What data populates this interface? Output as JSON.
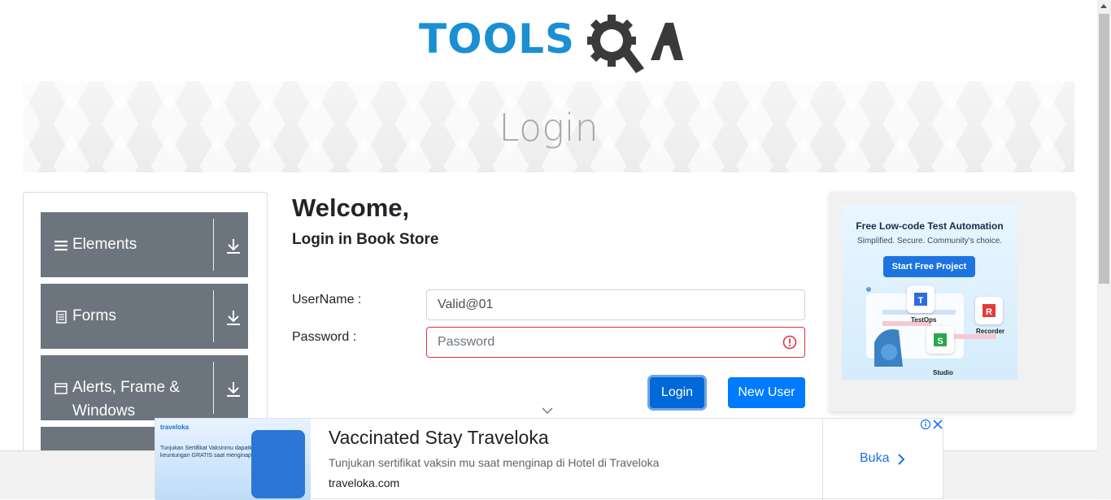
{
  "logo": {
    "text_main": "TOOLS",
    "text_q": "Q",
    "text_a": "A"
  },
  "banner": {
    "title": "Login"
  },
  "sidebar": {
    "groups": [
      {
        "label": "Elements",
        "icon": "hamburger-icon"
      },
      {
        "label": "Forms",
        "icon": "document-icon"
      },
      {
        "label": "Alerts, Frame & Windows",
        "icon": "window-icon"
      }
    ]
  },
  "main": {
    "welcome": "Welcome,",
    "subtitle": "Login in Book Store",
    "username_label": "UserName :",
    "username_value": "Valid@01",
    "password_label": "Password :",
    "password_placeholder": "Password",
    "login_button": "Login",
    "new_user_button": "New User"
  },
  "ad_right": {
    "headline": "Free Low-code Test Automation",
    "tagline": "Simplified. Secure. Community's choice.",
    "cta": "Start Free Project",
    "tiles": [
      "TestOps",
      "Recorder",
      "Studio"
    ]
  },
  "ad_bottom": {
    "image_brand": "traveloka",
    "image_text": "Tunjukan Sertifikat Vaksinmu dapatkan keuntungan GRATIS saat menginap",
    "title": "Vaccinated Stay Traveloka",
    "description": "Tunjukan sertifikat vaksin mu saat menginap di Hotel di Traveloka",
    "url": "traveloka.com",
    "cta": "Buka"
  },
  "colors": {
    "primary": "#007bff",
    "sidebar_group": "#6c757d",
    "error": "#dc3545",
    "logo_blue": "#1a8fd2",
    "logo_dark": "#3a3a3a"
  }
}
